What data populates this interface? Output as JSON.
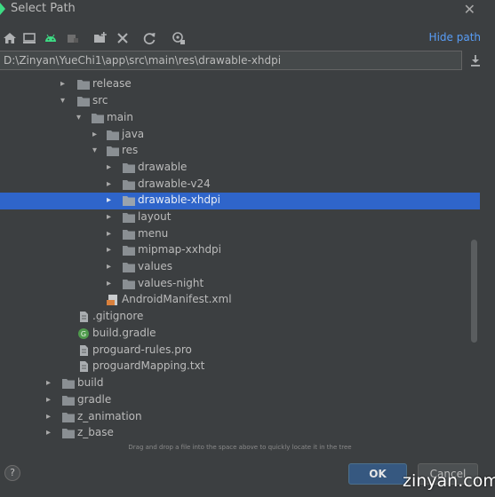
{
  "window": {
    "title": "Select Path"
  },
  "toolbar": {
    "icons": [
      "home-icon",
      "desktop-icon",
      "android-icon",
      "project-module-icon",
      "new-folder-icon",
      "delete-icon",
      "refresh-icon",
      "show-hidden-icon"
    ],
    "hide_path_label": "Hide path"
  },
  "path": {
    "value": "D:\\Zinyan\\YueChi1\\app\\src\\main\\res\\drawable-xhdpi"
  },
  "tree": {
    "rows": [
      {
        "label": "release",
        "type": "folder",
        "expanded": false
      },
      {
        "label": "src",
        "type": "folder",
        "expanded": true
      },
      {
        "label": "main",
        "type": "folder",
        "expanded": true
      },
      {
        "label": "java",
        "type": "folder",
        "expanded": false
      },
      {
        "label": "res",
        "type": "folder",
        "expanded": true
      },
      {
        "label": "drawable",
        "type": "folder",
        "expanded": false
      },
      {
        "label": "drawable-v24",
        "type": "folder",
        "expanded": false
      },
      {
        "label": "drawable-xhdpi",
        "type": "folder",
        "expanded": false,
        "selected": true
      },
      {
        "label": "layout",
        "type": "folder",
        "expanded": false
      },
      {
        "label": "menu",
        "type": "folder",
        "expanded": false
      },
      {
        "label": "mipmap-xxhdpi",
        "type": "folder",
        "expanded": false
      },
      {
        "label": "values",
        "type": "folder",
        "expanded": false
      },
      {
        "label": "values-night",
        "type": "folder",
        "expanded": false
      },
      {
        "label": "AndroidManifest.xml",
        "type": "xml-file"
      },
      {
        "label": ".gitignore",
        "type": "text-file"
      },
      {
        "label": "build.gradle",
        "type": "gradle-file"
      },
      {
        "label": "proguard-rules.pro",
        "type": "text-file"
      },
      {
        "label": "proguardMapping.txt",
        "type": "text-file"
      },
      {
        "label": "build",
        "type": "folder",
        "expanded": false
      },
      {
        "label": "gradle",
        "type": "folder",
        "expanded": false
      },
      {
        "label": "z_animation",
        "type": "folder",
        "expanded": false
      },
      {
        "label": "z_base",
        "type": "folder",
        "expanded": false
      }
    ]
  },
  "hint": "Drag and drop a file into the space above to quickly locate it in the tree",
  "buttons": {
    "help": "?",
    "ok": "OK",
    "cancel": "Cancel"
  },
  "watermark": "zinyan.com",
  "colors": {
    "background": "#3c3f41",
    "selection": "#2f65ca",
    "link": "#589df6",
    "folder": "#8a8f93",
    "ok_button": "#365880"
  }
}
